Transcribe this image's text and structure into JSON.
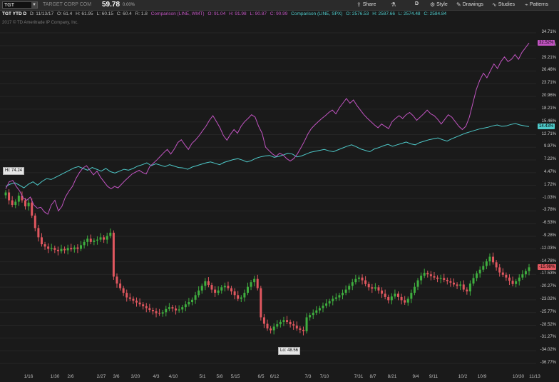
{
  "toolbar": {
    "symbol": "TGT",
    "company": "TARGET CORP COM",
    "last": "59.78",
    "change_pct": "0.00%",
    "share_label": "Share",
    "period_label": "D",
    "style_label": "Style",
    "drawings_label": "Drawings",
    "studies_label": "Studies",
    "patterns_label": "Patterns"
  },
  "legend": {
    "title": "TGT YTD D",
    "date": "D: 11/13/17",
    "open": "O: 61.4",
    "high": "H: 61.95",
    "low": "L: 60.15",
    "close": "C: 60.4",
    "range": "R: 1.8",
    "wmt_label": "Comparison (LINE, WMT)",
    "wmt_o": "O: 91.04",
    "wmt_h": "H: 91.98",
    "wmt_l": "L: 90.87",
    "wmt_c": "C: 90.99",
    "spx_label": "Comparison (LINE, SPX)",
    "spx_o": "O: 2576.53",
    "spx_h": "H: 2587.66",
    "spx_l": "L: 2574.48",
    "spx_c": "C: 2584.84"
  },
  "copyright": "2017 © TD Ameritrade IP Company, Inc.",
  "colors": {
    "up": "#3fae3f",
    "down": "#e0575f",
    "wmt": "#c154c1",
    "spx": "#4ec9c9",
    "background": "#1a1a1a"
  },
  "icons": [
    "share-icon",
    "flask-icon",
    "style-icon",
    "drawings-icon",
    "studies-icon",
    "patterns-icon",
    "dropdown-icon"
  ],
  "chart_data": {
    "type": "candlestick",
    "y_ticks": [
      "34.71%",
      "31.96%",
      "29.21%",
      "26.46%",
      "23.71%",
      "20.96%",
      "18.21%",
      "15.46%",
      "12.71%",
      "9.97%",
      "7.22%",
      "4.47%",
      "1.72%",
      "-1.03%",
      "-3.78%",
      "-6.53%",
      "-9.28%",
      "-12.03%",
      "-14.78%",
      "-17.53%",
      "-20.27%",
      "-23.02%",
      "-25.77%",
      "-28.52%",
      "-31.27%",
      "-34.02%",
      "-36.77%"
    ],
    "x_ticks": [
      "1/16",
      "1/30",
      "2/6",
      "2/27",
      "3/6",
      "3/20",
      "4/3",
      "4/10",
      "5/1",
      "5/8",
      "5/15",
      "6/5",
      "6/12",
      "7/3",
      "7/10",
      "7/31",
      "8/7",
      "8/21",
      "9/4",
      "9/11",
      "10/2",
      "10/9",
      "10/30",
      "11/13"
    ],
    "ylim": [
      -38,
      36
    ],
    "hi_label": "Hi: 74.24",
    "lo_label": "Lo: 48.56",
    "tgt_flag": "-15.98%",
    "wmt_flag": "32.52%",
    "spx_flag": "14.43%",
    "tgt_pct": [
      0.2,
      -1.5,
      -2.5,
      -1.8,
      -0.5,
      -1.5,
      -2.8,
      -2.0,
      -4.8,
      -7.5,
      -9.5,
      -11.0,
      -11.5,
      -12.0,
      -11.8,
      -12.2,
      -12.5,
      -12.0,
      -12.3,
      -11.8,
      -12.1,
      -11.7,
      -12.0,
      -11.2,
      -10.5,
      -9.8,
      -10.5,
      -10.2,
      -10.0,
      -9.5,
      -10.0,
      -9.2,
      -8.5,
      -18.0,
      -19.5,
      -20.5,
      -21.5,
      -22.5,
      -22.8,
      -23.2,
      -23.6,
      -24.0,
      -24.4,
      -24.8,
      -25.2,
      -25.5,
      -25.9,
      -26.0,
      -25.7,
      -25.0,
      -24.6,
      -24.9,
      -25.3,
      -25.1,
      -24.6,
      -24.0,
      -23.5,
      -23.0,
      -22.0,
      -21.0,
      -20.0,
      -19.0,
      -19.8,
      -20.8,
      -21.5,
      -21.0,
      -20.3,
      -20.0,
      -20.5,
      -21.2,
      -22.0,
      -22.8,
      -22.5,
      -21.5,
      -20.2,
      -19.2,
      -18.5,
      -20.5,
      -26.8,
      -28.2,
      -29.2,
      -29.6,
      -28.8,
      -28.3,
      -27.8,
      -27.4,
      -27.8,
      -28.3,
      -28.6,
      -29.2,
      -29.5,
      -29.8,
      -26.8,
      -26.3,
      -25.8,
      -25.3,
      -24.8,
      -24.3,
      -23.8,
      -23.3,
      -22.8,
      -22.5,
      -22.0,
      -21.5,
      -20.8,
      -20.0,
      -19.2,
      -18.5,
      -18.2,
      -18.8,
      -19.6,
      -20.3,
      -20.6,
      -20.3,
      -21.0,
      -21.7,
      -22.4,
      -23.1,
      -22.3,
      -21.7,
      -22.4,
      -23.1,
      -23.6,
      -22.8,
      -21.5,
      -20.2,
      -18.8,
      -17.8,
      -17.2,
      -17.5,
      -17.9,
      -18.2,
      -18.5,
      -18.3,
      -18.7,
      -19.0,
      -19.3,
      -19.7,
      -20.0,
      -19.7,
      -20.8,
      -21.2,
      -19.5,
      -18.3,
      -17.3,
      -16.5,
      -15.7,
      -14.7,
      -13.7,
      -14.9,
      -16.0,
      -17.1,
      -17.6,
      -18.2,
      -18.9,
      -19.6,
      -19.0,
      -18.2,
      -17.5,
      -16.8,
      -15.98
    ],
    "wmt_pct": [
      1.0,
      2.5,
      2.8,
      1.5,
      0.5,
      -1.0,
      -1.5,
      -0.8,
      -2.5,
      -3.2,
      -3.0,
      -4.0,
      -4.5,
      -2.5,
      -1.5,
      -3.8,
      -2.8,
      -0.8,
      0.5,
      1.5,
      3.2,
      4.5,
      5.5,
      6.0,
      5.0,
      4.0,
      4.8,
      3.5,
      2.5,
      1.5,
      1.0,
      1.5,
      1.2,
      2.0,
      2.8,
      3.5,
      4.2,
      4.6,
      5.0,
      4.5,
      4.2,
      5.8,
      6.5,
      7.2,
      8.0,
      8.8,
      9.5,
      8.5,
      9.6,
      11.0,
      11.6,
      10.5,
      9.5,
      10.8,
      11.5,
      12.4,
      13.5,
      14.5,
      15.8,
      16.8,
      15.5,
      14.2,
      12.5,
      11.5,
      12.8,
      13.8,
      13.0,
      14.5,
      15.5,
      16.2,
      17.0,
      16.5,
      14.5,
      13.0,
      10.0,
      9.2,
      8.5,
      8.0,
      8.7,
      8.3,
      7.5,
      7.0,
      7.5,
      8.5,
      9.8,
      11.2,
      12.8,
      14.0,
      14.8,
      15.5,
      16.2,
      16.8,
      17.5,
      18.0,
      17.2,
      18.5,
      19.5,
      20.5,
      19.5,
      20.2,
      19.0,
      18.0,
      17.0,
      16.2,
      15.5,
      14.8,
      14.2,
      15.0,
      14.5,
      14.0,
      15.5,
      16.2,
      16.8,
      16.2,
      17.0,
      17.5,
      16.8,
      15.8,
      16.5,
      17.2,
      18.0,
      17.2,
      16.8,
      16.0,
      15.0,
      16.0,
      17.0,
      16.5,
      15.5,
      14.5,
      13.8,
      14.5,
      16.5,
      19.5,
      22.5,
      24.5,
      26.0,
      25.0,
      26.5,
      28.0,
      27.0,
      28.5,
      29.5,
      28.5,
      29.0,
      30.0,
      29.0,
      30.5,
      31.5,
      32.52
    ],
    "spx_pct": [
      1.5,
      2.0,
      2.3,
      1.8,
      1.2,
      2.0,
      2.5,
      1.8,
      2.6,
      3.2,
      3.0,
      3.5,
      4.0,
      4.5,
      5.0,
      5.5,
      5.8,
      5.4,
      5.0,
      5.6,
      5.2,
      4.8,
      5.4,
      4.7,
      4.4,
      4.8,
      5.2,
      5.0,
      5.4,
      5.9,
      6.2,
      6.6,
      6.0,
      6.4,
      6.1,
      5.8,
      6.2,
      5.9,
      5.6,
      5.5,
      5.2,
      5.7,
      6.0,
      6.3,
      6.6,
      6.8,
      6.5,
      6.2,
      6.7,
      7.0,
      7.3,
      7.5,
      7.2,
      6.8,
      7.1,
      7.6,
      7.9,
      8.1,
      8.2,
      7.8,
      8.0,
      8.3,
      8.7,
      8.5,
      7.9,
      8.1,
      8.5,
      8.9,
      9.1,
      9.3,
      9.5,
      9.2,
      9.0,
      9.4,
      9.8,
      10.2,
      10.5,
      10.1,
      9.6,
      9.3,
      9.0,
      9.6,
      9.9,
      10.3,
      10.6,
      10.2,
      10.5,
      10.8,
      11.1,
      10.7,
      10.5,
      11.0,
      11.3,
      11.6,
      11.8,
      12.0,
      11.6,
      11.3,
      11.8,
      12.2,
      12.6,
      13.0,
      13.3,
      13.6,
      13.9,
      14.1,
      14.3,
      14.6,
      14.8,
      14.5,
      14.6,
      14.9,
      15.1,
      14.8,
      14.6,
      14.43
    ]
  }
}
